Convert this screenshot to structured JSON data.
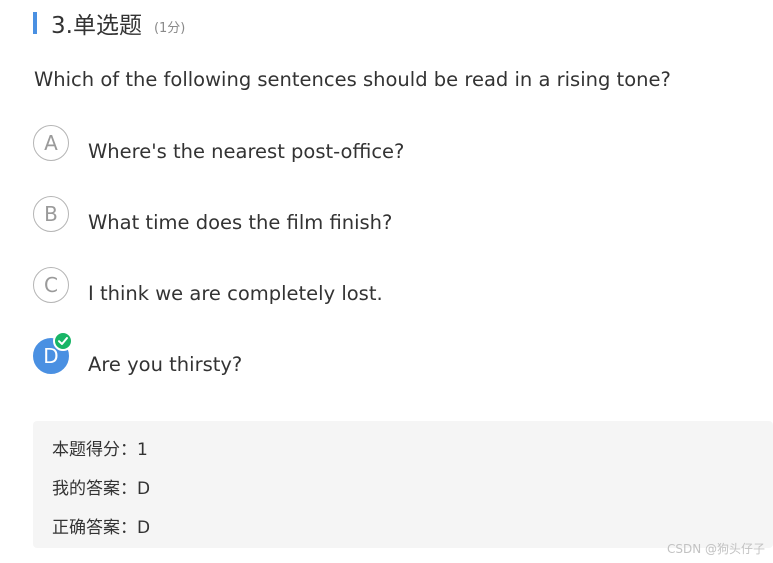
{
  "question": {
    "number_title": "3.单选题",
    "score_label": "(1分)",
    "text": "Which of the following sentences should be read in a rising tone?"
  },
  "options": [
    {
      "letter": "A",
      "text": "Where's the nearest post-office?",
      "selected": false
    },
    {
      "letter": "B",
      "text": "What time does the film finish?",
      "selected": false
    },
    {
      "letter": "C",
      "text": "I think we are completely lost.",
      "selected": false
    },
    {
      "letter": "D",
      "text": "Are you thirsty?",
      "selected": true
    }
  ],
  "result": {
    "score_line": "本题得分：1",
    "my_answer_line": "我的答案：D",
    "correct_answer_line": "正确答案：D"
  },
  "watermark": "CSDN @狗头仔子",
  "colors": {
    "accent": "#4a90e2",
    "check": "#18b566",
    "panel_bg": "#f5f5f5"
  },
  "icons": {
    "correct_badge": "check-icon"
  }
}
